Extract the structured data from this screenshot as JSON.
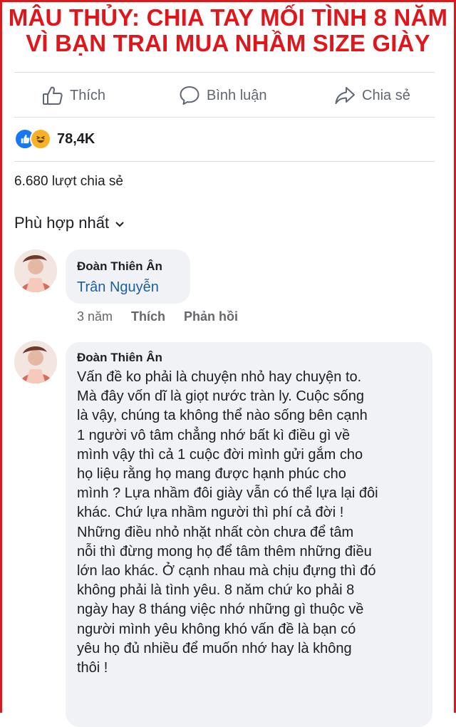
{
  "headline": {
    "line1": "MÂU THỦY: CHIA TAY MỐI TÌNH 8 NĂM",
    "line2": "VÌ BẠN TRAI MUA NHẦM SIZE GIÀY",
    "color": "#e0161d"
  },
  "actions": [
    {
      "label": "Thích",
      "icon": "thumbs-up-icon"
    },
    {
      "label": "Bình luận",
      "icon": "comment-icon"
    },
    {
      "label": "Chia sẻ",
      "icon": "share-icon"
    }
  ],
  "reactions": {
    "count": "78,4K",
    "icons": [
      "like-icon",
      "haha-icon"
    ]
  },
  "shares_text": "6.680 lượt chia sẻ",
  "sort": {
    "label": "Phù hợp nhất",
    "icon": "chevron-down-icon"
  },
  "comments": [
    {
      "author": "Đoàn Thiên Ân",
      "mention": "Trân Nguyễn",
      "time": "3 năm",
      "like_label": "Thích",
      "reply_label": "Phản hồi"
    },
    {
      "author": "Đoàn Thiên Ân",
      "lines": [
        "Vấn đề ko phải là chuyện nhỏ hay chuyện to.",
        "Mà đây vốn dĩ là giọt nước tràn ly. Cuộc sống",
        "là vậy, chúng ta không thể nào sống bên cạnh",
        "1 người vô tâm chẳng nhớ bất kì điều gì về",
        "mình vậy thì cả 1 cuộc đời mình gửi gắm cho",
        "họ liệu rằng họ mang được hạnh phúc cho",
        "mình ? Lựa nhầm đôi giày vẫn có thể lựa lại đôi",
        "khác. Chứ lựa nhầm người thì phí cả đời !",
        "Những điều nhỏ nhặt nhất còn chưa để tâm",
        "nỗi thì đừng mong họ để tâm thêm những điều",
        "lớn lao khác. Ở cạnh nhau mà chịu đựng thì đó",
        "không phải là tình yêu. 8 năm chứ ko phải 8",
        "ngày hay 8 tháng việc nhớ những gì thuộc về",
        "người mình yêu không khó vấn đề là bạn có",
        "yêu họ đủ nhiều để muốn nhớ hay là không",
        "thôi !"
      ]
    }
  ]
}
